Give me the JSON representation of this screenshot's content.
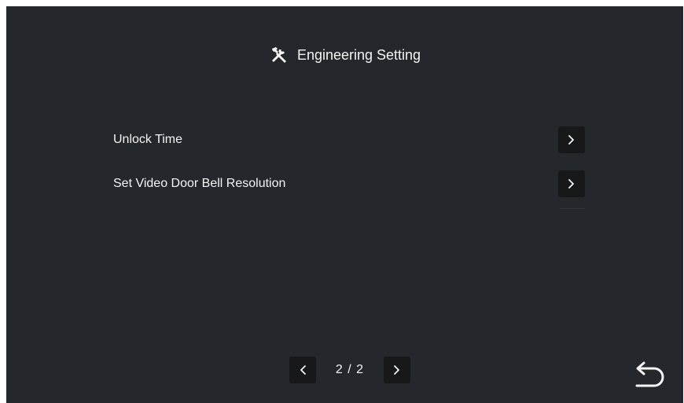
{
  "header": {
    "icon": "tools-icon",
    "title": "Engineering Setting"
  },
  "menu": {
    "items": [
      {
        "label": "Unlock Time",
        "icon": "chevron-right-icon"
      },
      {
        "label": "Set Video Door Bell Resolution",
        "icon": "chevron-right-icon"
      }
    ]
  },
  "pager": {
    "prev_icon": "chevron-left-icon",
    "next_icon": "chevron-right-icon",
    "page_label": "2 / 2"
  },
  "back": {
    "icon": "back-arrow-icon"
  },
  "colors": {
    "background": "#24272b",
    "button": "#17181a",
    "text": "#f4f4f4"
  }
}
